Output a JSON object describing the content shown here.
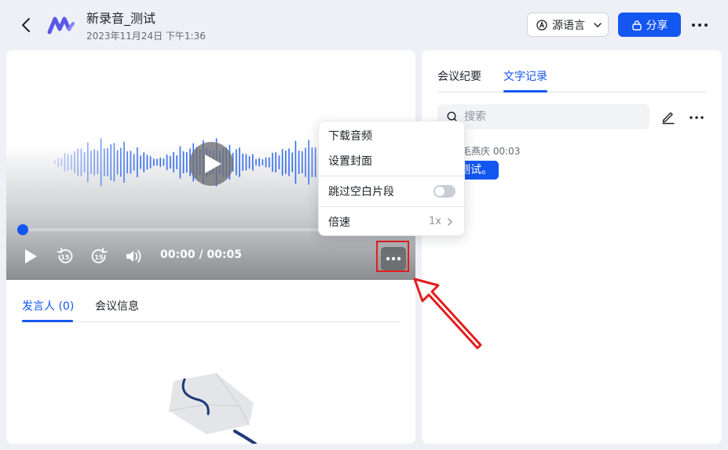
{
  "header": {
    "title": "新录音_测试",
    "datetime": "2023年11月24日 下午1:36",
    "language_label": "源语言",
    "share_label": "分享"
  },
  "player": {
    "time": "00:00 / 00:05",
    "progress": 0.0,
    "skip_back": "15",
    "skip_forward": "15"
  },
  "left_tabs": [
    {
      "label": "发言人 (0)",
      "active": true
    },
    {
      "label": "会议信息",
      "active": false
    }
  ],
  "right_tabs": [
    {
      "label": "会议纪要",
      "active": false
    },
    {
      "label": "文字记录",
      "active": true
    }
  ],
  "search": {
    "placeholder": "搜索"
  },
  "transcript": {
    "speaker_time": "毛燕庆  00:03",
    "text": "测试。"
  },
  "menu": {
    "download_audio": "下载音频",
    "set_cover": "设置封面",
    "skip_silence": "跳过空白片段",
    "skip_silence_on": false,
    "speed_label": "倍速",
    "speed_value": "1x"
  },
  "colors": {
    "accent": "#1456f0",
    "annotation_red": "#e21d1d"
  }
}
